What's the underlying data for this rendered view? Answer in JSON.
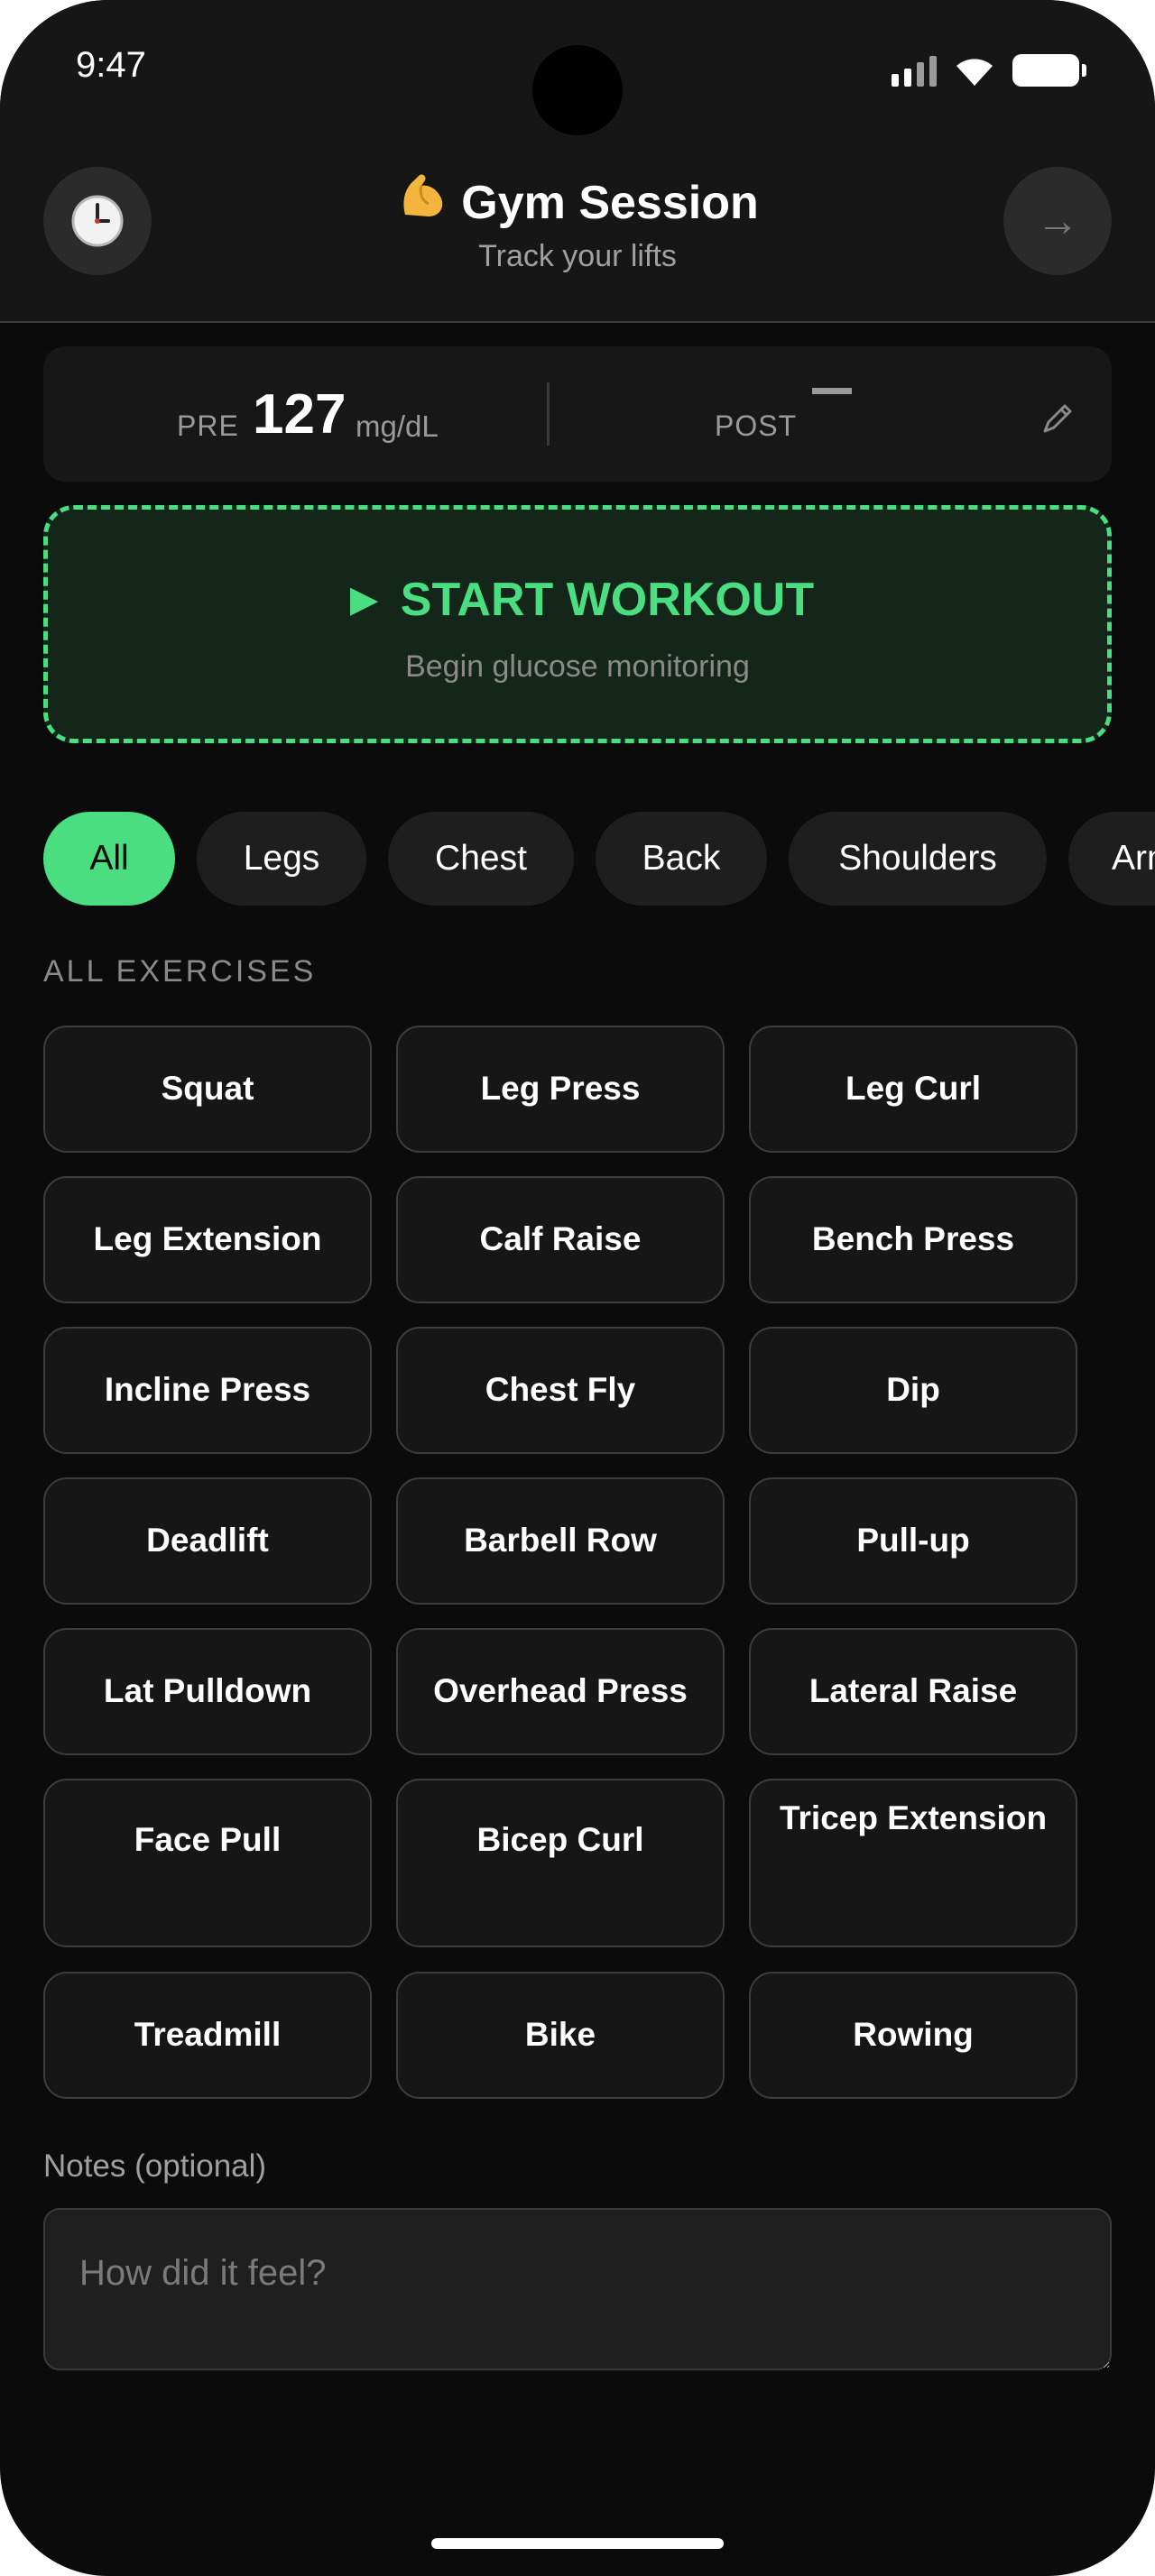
{
  "status_bar": {
    "time": "9:47",
    "icons": [
      "signal-icon",
      "wifi-icon",
      "battery-icon"
    ]
  },
  "header": {
    "left_icon": "clock-icon",
    "title_icon": "flexed-biceps-icon",
    "title": "Gym Session",
    "subtitle": "Track your lifts",
    "right_icon": "arrow-right-icon",
    "right_label": "→"
  },
  "glucose": {
    "pre_label": "PRE",
    "pre_value": "127",
    "unit": "mg/dL",
    "post_label": "POST",
    "post_value": "—",
    "edit_icon": "pencil-icon"
  },
  "start_workout": {
    "label": "► START WORKOUT",
    "sublabel": "Begin glucose monitoring"
  },
  "filters": {
    "selected": "All",
    "items": [
      "All",
      "Legs",
      "Chest",
      "Back",
      "Shoulders",
      "Arms"
    ]
  },
  "section_label": "ALL EXERCISES",
  "exercises": [
    "Squat",
    "Leg Press",
    "Leg Curl",
    "Leg Extension",
    "Calf Raise",
    "Bench Press",
    "Incline Press",
    "Chest Fly",
    "Dip",
    "Deadlift",
    "Barbell Row",
    "Pull-up",
    "Lat Pulldown",
    "Overhead Press",
    "Lateral Raise",
    "Face Pull",
    "Bicep Curl",
    "Tricep Extension",
    "Treadmill",
    "Bike",
    "Rowing"
  ],
  "notes": {
    "label": "Notes (optional)",
    "placeholder": "How did it feel?",
    "value": ""
  },
  "colors": {
    "background": "#0b0b0b",
    "header_bg": "#161616",
    "accent": "#4ade80",
    "card_bg": "#171717",
    "muted_text": "#9a9a9a"
  }
}
